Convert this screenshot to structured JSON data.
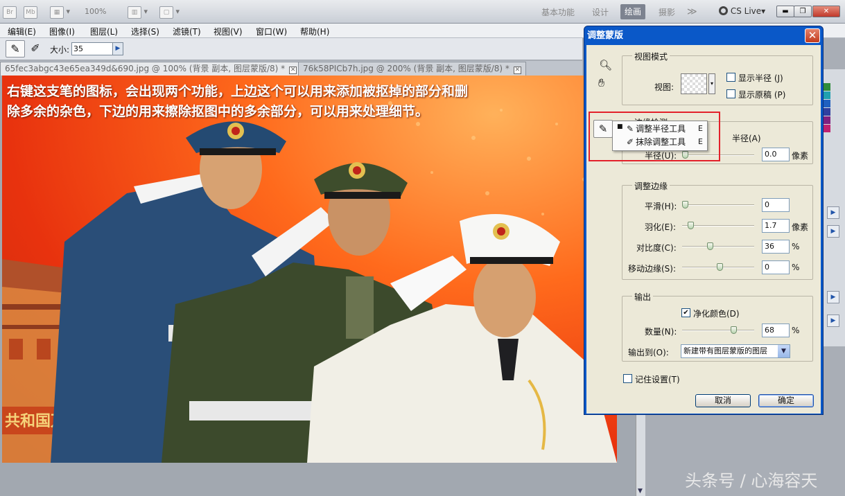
{
  "appbar": {
    "zoom": "100%",
    "workspaces": [
      "基本功能",
      "设计",
      "绘画",
      "摄影"
    ],
    "active_workspace": "绘画",
    "more": "≫",
    "cslive": "CS Live▾"
  },
  "menus": [
    "编辑(E)",
    "图像(I)",
    "图层(L)",
    "选择(S)",
    "滤镜(T)",
    "视图(V)",
    "窗口(W)",
    "帮助(H)"
  ],
  "options": {
    "size_label": "大小:",
    "size_value": "35"
  },
  "tabs": [
    {
      "label": "65fec3abgc43e65ea349d&690.jpg @ 100% (背景 副本, 图层蒙版/8) *"
    },
    {
      "label": "76k58PICb7h.jpg @ 200% (背景 副本, 图层蒙版/8) *"
    }
  ],
  "caption": "右键这支笔的图标，会出现两个功能，上边这个可以用来添加被抠掉的部分和删除多余的杂色，下边的用来擦除抠图中的多余部分，可以用来处理细节。",
  "photo": {
    "banner_text": "共和国万岁"
  },
  "watermark": "头条号 / 心海容天",
  "dialog": {
    "title": "调整蒙版",
    "view_group": "视图模式",
    "view_label": "视图:",
    "show_radius": "显示半径 (J)",
    "show_original": "显示原稿 (P)",
    "edge_group": "边缘检测",
    "smart_radius_tail": "半径(A)",
    "radius_label": "半径(U):",
    "radius_value": "0.0",
    "radius_unit": "像素",
    "adjust_group": "调整边缘",
    "smooth_label": "平滑(H):",
    "smooth_value": "0",
    "feather_label": "羽化(E):",
    "feather_value": "1.7",
    "feather_unit": "像素",
    "contrast_label": "对比度(C):",
    "contrast_value": "36",
    "contrast_unit": "%",
    "shift_label": "移动边缘(S):",
    "shift_value": "0",
    "shift_unit": "%",
    "output_group": "输出",
    "decontam_label": "净化颜色(D)",
    "amount_label": "数量(N):",
    "amount_value": "68",
    "amount_unit": "%",
    "output_to_label": "输出到(O):",
    "output_to_value": "新建带有图层蒙版的图层",
    "remember": "记住设置(T)",
    "cancel": "取消",
    "ok": "确定"
  },
  "popup": {
    "item1": "调整半径工具",
    "item1_key": "E",
    "item2": "抹除调整工具",
    "item2_key": "E"
  }
}
